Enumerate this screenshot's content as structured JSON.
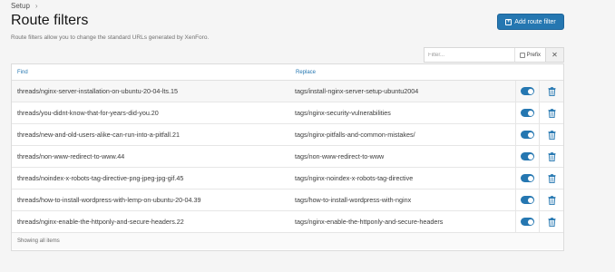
{
  "breadcrumb": {
    "label": "Setup"
  },
  "page": {
    "title": "Route filters",
    "description": "Route filters allow you to change the standard URLs generated by XenForo."
  },
  "toolbar": {
    "add_label": "Add route filter"
  },
  "filter": {
    "placeholder": "Filter...",
    "prefix_label": "Prefix",
    "clear_symbol": "✕"
  },
  "table": {
    "columns": {
      "find": "Find",
      "replace": "Replace"
    },
    "rows": [
      {
        "find": "threads/nginx-server-installation-on-ubuntu-20-04-lts.15",
        "replace": "tags/install-nginx-server-setup-ubuntu2004",
        "enabled": true
      },
      {
        "find": "threads/you-didnt-know-that-for-years-did-you.20",
        "replace": "tags/nginx-security-vulnerabilities",
        "enabled": true
      },
      {
        "find": "threads/new-and-old-users-alike-can-run-into-a-pitfall.21",
        "replace": "tags/nginx-pitfalls-and-common-mistakes/",
        "enabled": true
      },
      {
        "find": "threads/non-www-redirect-to-www.44",
        "replace": "tags/non-www-redirect-to-www",
        "enabled": true
      },
      {
        "find": "threads/noindex-x-robots-tag-directive-png-jpeg-jpg-gif.45",
        "replace": "tags/nginx-noindex-x-robots-tag-directive",
        "enabled": true
      },
      {
        "find": "threads/how-to-install-wordpress-with-lemp-on-ubuntu-20-04.39",
        "replace": "tags/how-to-install-wordpress-with-nginx",
        "enabled": true
      },
      {
        "find": "threads/nginx-enable-the-httponly-and-secure-headers.22",
        "replace": "tags/nginx-enable-the-httponly-and-secure-headers",
        "enabled": true
      }
    ],
    "footer": "Showing all items"
  },
  "colors": {
    "accent": "#2577b1",
    "page_bg": "#f5f5f5"
  },
  "icons": {
    "add": "plus-square-icon",
    "toggle": "toggle-switch-icon",
    "delete": "trash-icon",
    "breadcrumb": "chevron-right-icon"
  }
}
